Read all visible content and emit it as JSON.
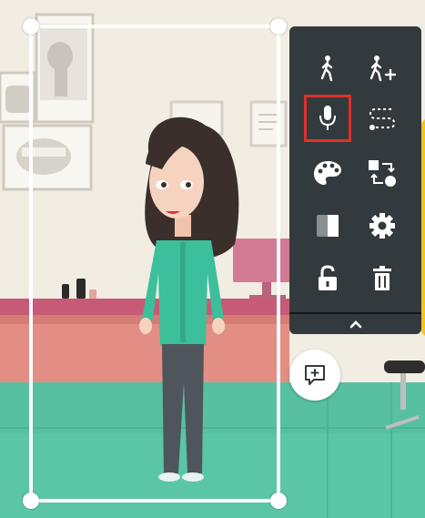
{
  "canvas": {
    "background_colors": {
      "wall": "#f1ede3",
      "floor": "#57c0a0",
      "desk": "#e38e84",
      "desk_top": "#c75a77",
      "accent_yellow": "#f7c21c"
    }
  },
  "character": {
    "name": "standing-woman-character",
    "colors": {
      "hair": "#3a2f2b",
      "shirt": "#3cbf9b",
      "pants": "#4e565c",
      "skin": "#f6d3bf"
    }
  },
  "selection_frame": {
    "color": "#ffffff",
    "handles": [
      "top-left",
      "top-right",
      "bottom-left",
      "bottom-right"
    ]
  },
  "toolbar": {
    "background": "#333a3d",
    "icon_color": "#ffffff",
    "selected_outline_color": "#e0302b",
    "buttons": [
      {
        "id": "walk",
        "icon": "walk-icon",
        "selected": false
      },
      {
        "id": "walk-add",
        "icon": "walk-plus-icon",
        "selected": false
      },
      {
        "id": "voice",
        "icon": "microphone-icon",
        "selected": true
      },
      {
        "id": "path",
        "icon": "motion-path-icon",
        "selected": false
      },
      {
        "id": "color",
        "icon": "palette-icon",
        "selected": false
      },
      {
        "id": "swap",
        "icon": "swap-icon",
        "selected": false
      },
      {
        "id": "contrast",
        "icon": "contrast-icon",
        "selected": false
      },
      {
        "id": "settings",
        "icon": "gear-icon",
        "selected": false
      },
      {
        "id": "lock",
        "icon": "unlock-icon",
        "selected": false
      },
      {
        "id": "delete",
        "icon": "trash-icon",
        "selected": false
      }
    ],
    "collapse_icon": "chevron-up-icon"
  },
  "comment_button": {
    "icon": "add-comment-icon"
  }
}
